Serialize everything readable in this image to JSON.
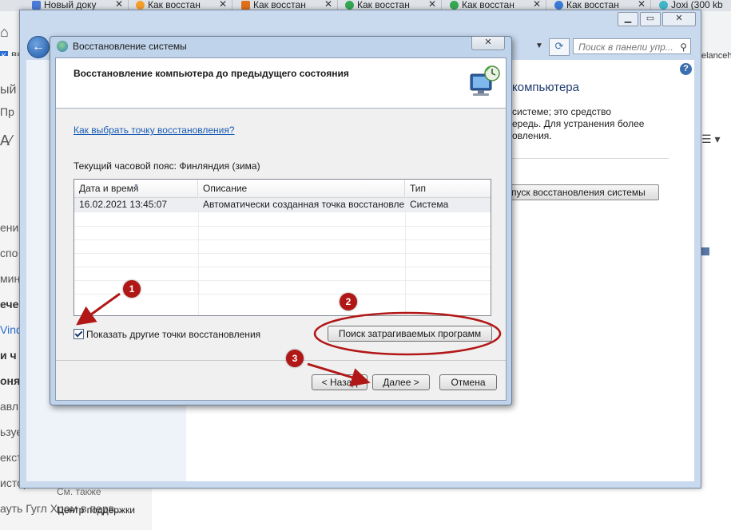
{
  "browser": {
    "tabs": [
      {
        "label": "Новый доку",
        "icon": "docs-icon",
        "color": "#4a7bd6"
      },
      {
        "label": "Как восстан",
        "icon": "orange-site-icon",
        "color": "#f5a02a"
      },
      {
        "label": "Как восстан",
        "icon": "fs-site-icon",
        "color": "#e0701a"
      },
      {
        "label": "Как восстан",
        "icon": "chrome-icon",
        "color": "#34a853"
      },
      {
        "label": "Как восстан",
        "icon": "chrome-icon",
        "color": "#34a853"
      },
      {
        "label": "Как восстан",
        "icon": "gear-site-icon",
        "color": "#3a7bd5"
      },
      {
        "label": "Joxi (300 kb",
        "icon": "joxi-icon",
        "color": "#3fb7c9"
      }
    ],
    "side_fragments": [
      "ВК",
      "elanceh",
      "ый д",
      "Пр",
      "ения",
      "спо",
      "мин",
      "ече",
      "Vind",
      "и ч",
      "оняте",
      "авл",
      "ьзуе",
      "екстн",
      "истор",
      "ауть Гугл Хром в перв..."
    ]
  },
  "control_panel": {
    "search_placeholder": "Поиск в панели упр...",
    "title": "компьютера",
    "description_lines": [
      "системе; это средство",
      "ередь. Для устранения более",
      "овления."
    ],
    "launch_button": "пуск восстановления системы",
    "see_also": "См. также",
    "support_center": "Центр поддержки",
    "help": "?"
  },
  "dialog": {
    "title": "Восстановление системы",
    "heading": "Восстановление компьютера до предыдущего состояния",
    "link": "Как выбрать точку восстановления?",
    "timezone": "Текущий часовой пояс: Финляндия (зима)",
    "table": {
      "columns": [
        "Дата и время",
        "Описание",
        "Тип"
      ],
      "rows": [
        [
          "16.02.2021 13:45:07",
          "Автоматически созданная точка восстановле...",
          "Система"
        ]
      ]
    },
    "checkbox_label": "Показать другие точки восстановления",
    "checkbox_checked": true,
    "scan_button": "Поиск затрагиваемых программ",
    "back_button": "< Назад",
    "next_button": "Далее >",
    "cancel_button": "Отмена"
  },
  "annotations": {
    "badges": [
      "1",
      "2",
      "3"
    ],
    "color": "#b11717"
  }
}
